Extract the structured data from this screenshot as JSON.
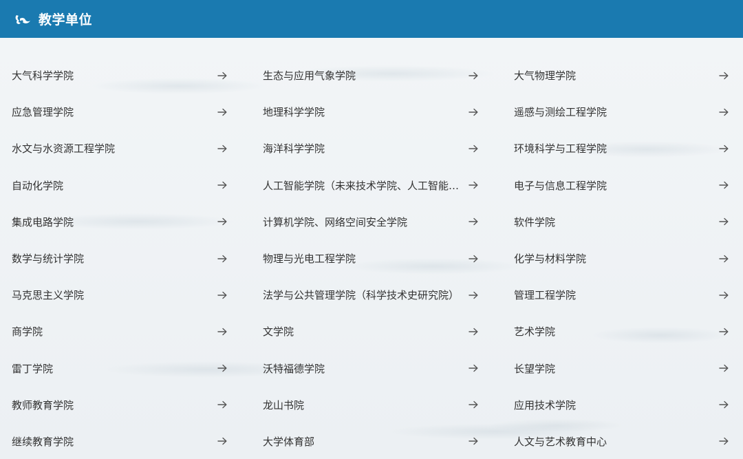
{
  "header": {
    "title": "教学单位",
    "logo_icon": "school-emblem-icon",
    "background_color": "#1a7ab0"
  },
  "units": [
    [
      "大气科学学院",
      "生态与应用气象学院",
      "大气物理学院"
    ],
    [
      "应急管理学院",
      "地理科学学院",
      "遥感与测绘工程学院"
    ],
    [
      "水文与水资源工程学院",
      "海洋科学学院",
      "环境科学与工程学院"
    ],
    [
      "自动化学院",
      "人工智能学院（未来技术学院、人工智能…",
      "电子与信息工程学院"
    ],
    [
      "集成电路学院",
      "计算机学院、网络空间安全学院",
      "软件学院"
    ],
    [
      "数学与统计学院",
      "物理与光电工程学院",
      "化学与材料学院"
    ],
    [
      "马克思主义学院",
      "法学与公共管理学院（科学技术史研究院）",
      "管理工程学院"
    ],
    [
      "商学院",
      "文学院",
      "艺术学院"
    ],
    [
      "雷丁学院",
      "沃特福德学院",
      "长望学院"
    ],
    [
      "教师教育学院",
      "龙山书院",
      "应用技术学院"
    ],
    [
      "继续教育学院",
      "大学体育部",
      "人文与艺术教育中心"
    ]
  ],
  "arrow_icon": "arrow-right-icon",
  "text_color": "#333333"
}
